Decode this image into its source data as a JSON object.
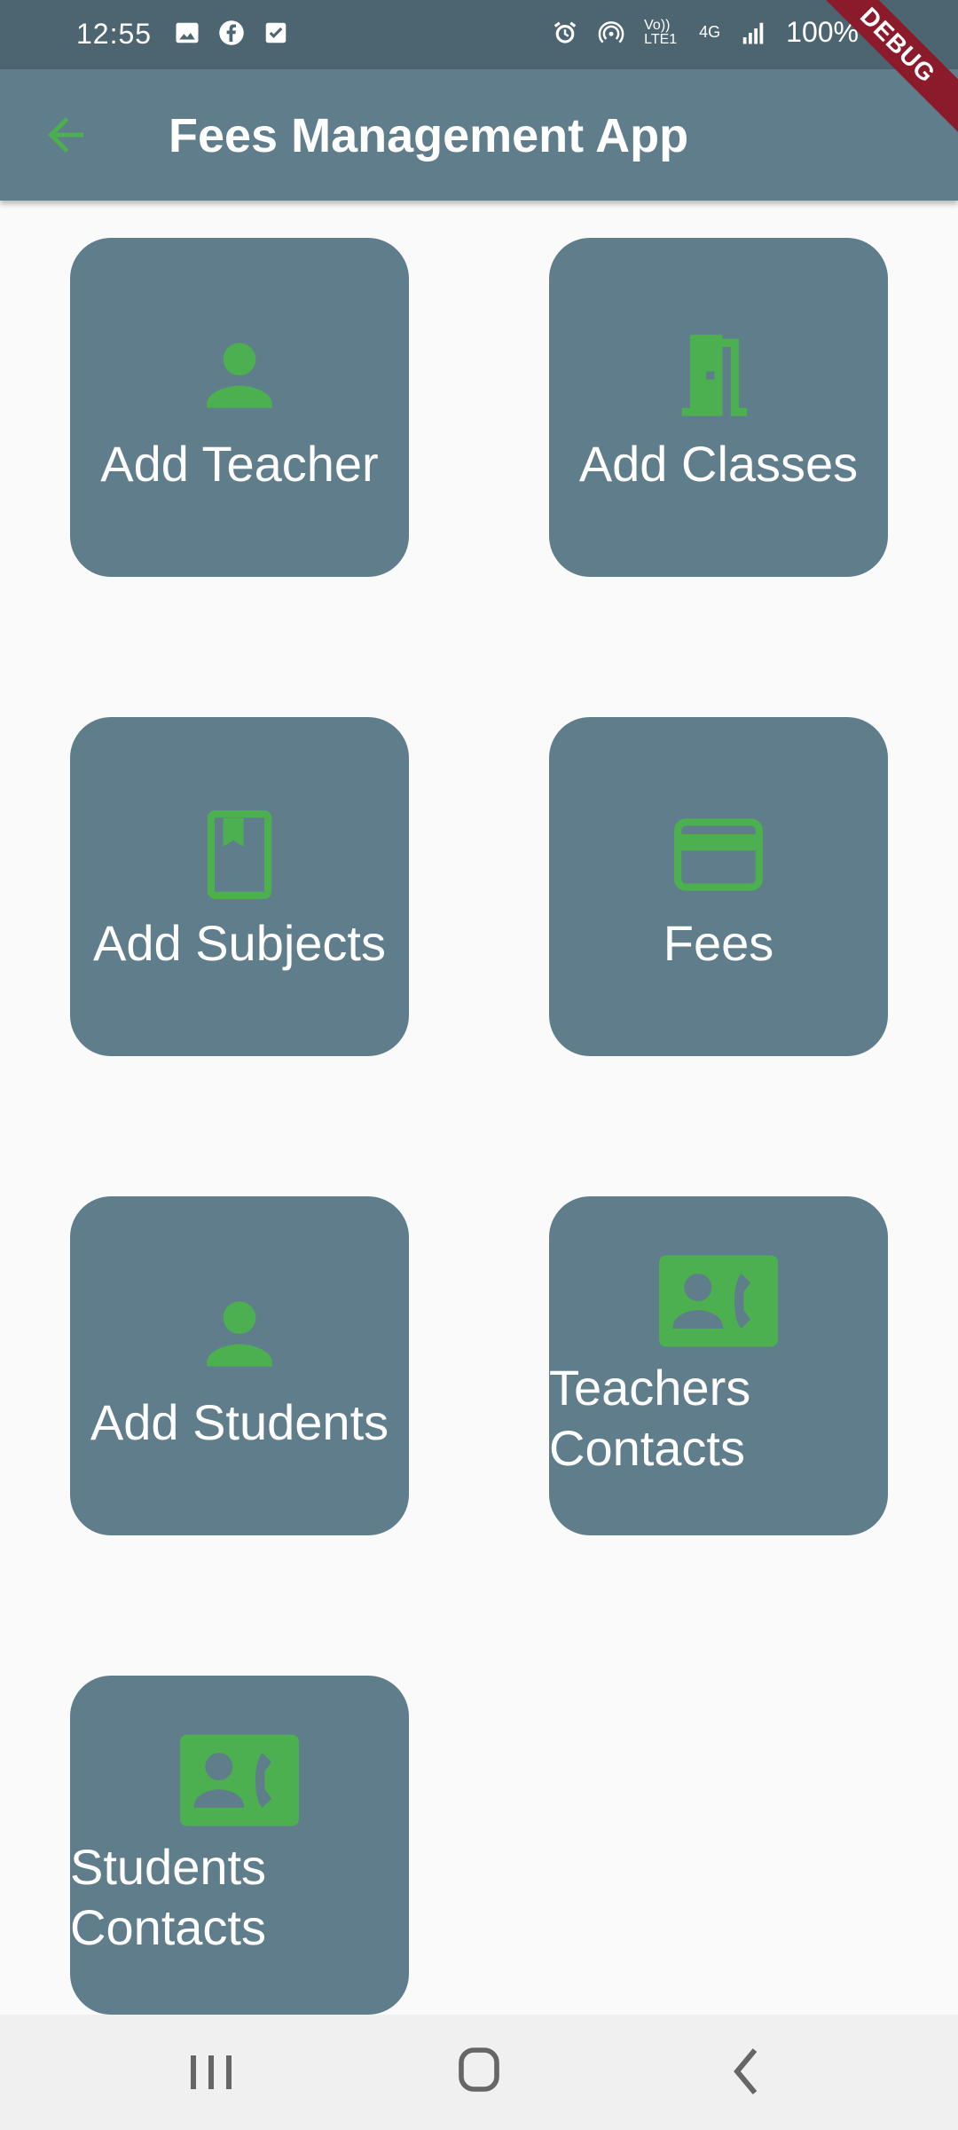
{
  "status_bar": {
    "time": "12:55",
    "network": "Vo)) LTE1",
    "network_type": "4G",
    "battery": "100%"
  },
  "app_bar": {
    "title": "Fees Management App",
    "back_icon": "arrow-back-icon",
    "accent_color": "#4caf50",
    "bar_color": "#607d8b"
  },
  "tiles": [
    {
      "label": "Add Teacher",
      "icon": "person-icon"
    },
    {
      "label": "Add Classes",
      "icon": "door-icon"
    },
    {
      "label": "Add Subjects",
      "icon": "book-icon"
    },
    {
      "label": "Fees",
      "icon": "credit-card-icon"
    },
    {
      "label": "Add Students",
      "icon": "person-icon"
    },
    {
      "label": "Teachers Contacts",
      "icon": "contact-phone-icon"
    },
    {
      "label": "Students Contacts",
      "icon": "contact-phone-icon"
    }
  ],
  "debug_banner": "DEBUG",
  "nav_bar": {
    "recents_icon": "recents-icon",
    "home_icon": "home-icon",
    "back_icon": "back-icon"
  }
}
